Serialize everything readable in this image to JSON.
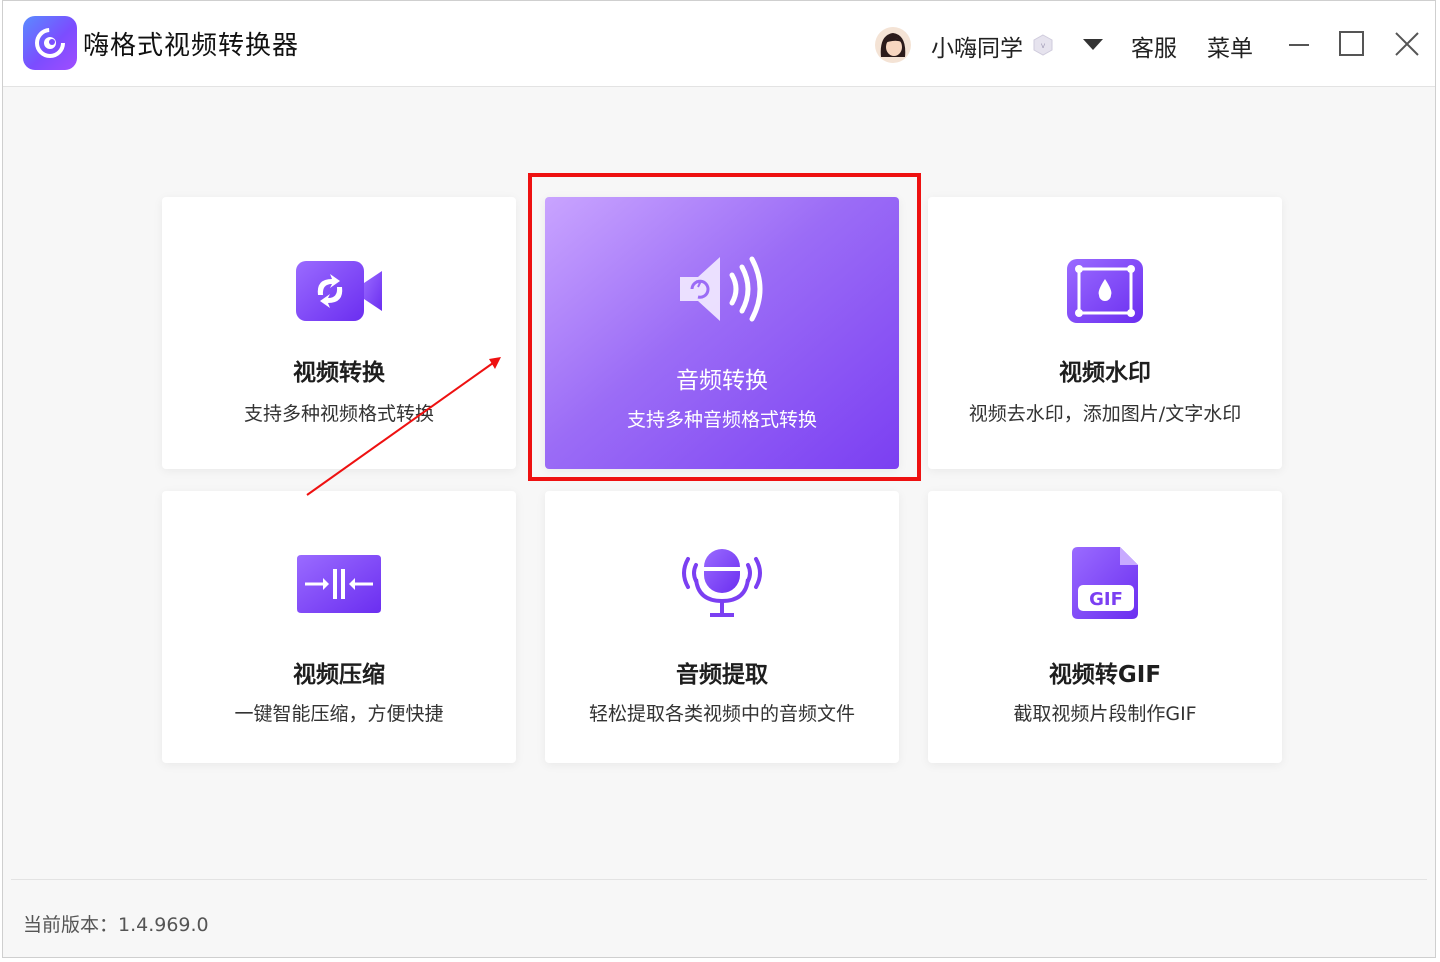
{
  "app": {
    "title": "嗨格式视频转换器"
  },
  "header": {
    "username": "小嗨同学",
    "support_label": "客服",
    "menu_label": "菜单"
  },
  "cards": [
    {
      "title": "视频转换",
      "desc": "支持多种视频格式转换",
      "icon": "video-convert-icon"
    },
    {
      "title": "音频转换",
      "desc": "支持多种音频格式转换",
      "icon": "audio-convert-icon",
      "selected": true
    },
    {
      "title": "视频水印",
      "desc": "视频去水印，添加图片/文字水印",
      "icon": "video-watermark-icon"
    },
    {
      "title": "视频压缩",
      "desc": "一键智能压缩，方便快捷",
      "icon": "video-compress-icon"
    },
    {
      "title": "音频提取",
      "desc": "轻松提取各类视频中的音频文件",
      "icon": "audio-extract-icon"
    },
    {
      "title": "视频转GIF",
      "desc": "截取视频片段制作GIF",
      "icon": "video-to-gif-icon",
      "badge": "GIF"
    }
  ],
  "footer": {
    "version": "当前版本：1.4.969.0"
  },
  "colors": {
    "accent": "#7b3ff2",
    "highlight": "#ee1111"
  }
}
